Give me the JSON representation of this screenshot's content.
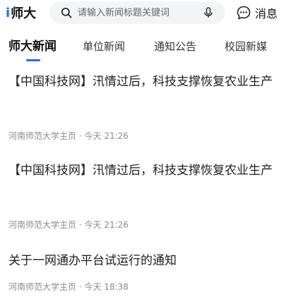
{
  "header": {
    "logo_mark": "i",
    "logo_text": "师大",
    "search_placeholder": "请输入新闻标题关键词",
    "messages_label": "消息"
  },
  "tabs": [
    {
      "label": "师大新闻",
      "active": true
    },
    {
      "label": "单位新闻",
      "active": false
    },
    {
      "label": "通知公告",
      "active": false
    },
    {
      "label": "校园新媒",
      "active": false
    }
  ],
  "news": [
    {
      "title": "【中国科技网】汛情过后，科技支撑恢复农业生产",
      "source": "河南师范大学主页",
      "separator": "·",
      "time": "今天 21:26"
    },
    {
      "title": "【中国科技网】汛情过后，科技支撑恢复农业生产",
      "source": "河南师范大学主页",
      "separator": "·",
      "time": "今天 21:26"
    },
    {
      "title": "关于一网通办平台试运行的通知",
      "source": "河南师范大学主页",
      "separator": "·",
      "time": "今天 18:38"
    }
  ],
  "colors": {
    "accent": "#1f6fe5",
    "search_bg": "#f3f4f6",
    "meta_text": "#8a8a8a"
  },
  "icons": {
    "search": "search-icon",
    "mic": "microphone-icon",
    "messages": "chat-bubble-icon"
  }
}
